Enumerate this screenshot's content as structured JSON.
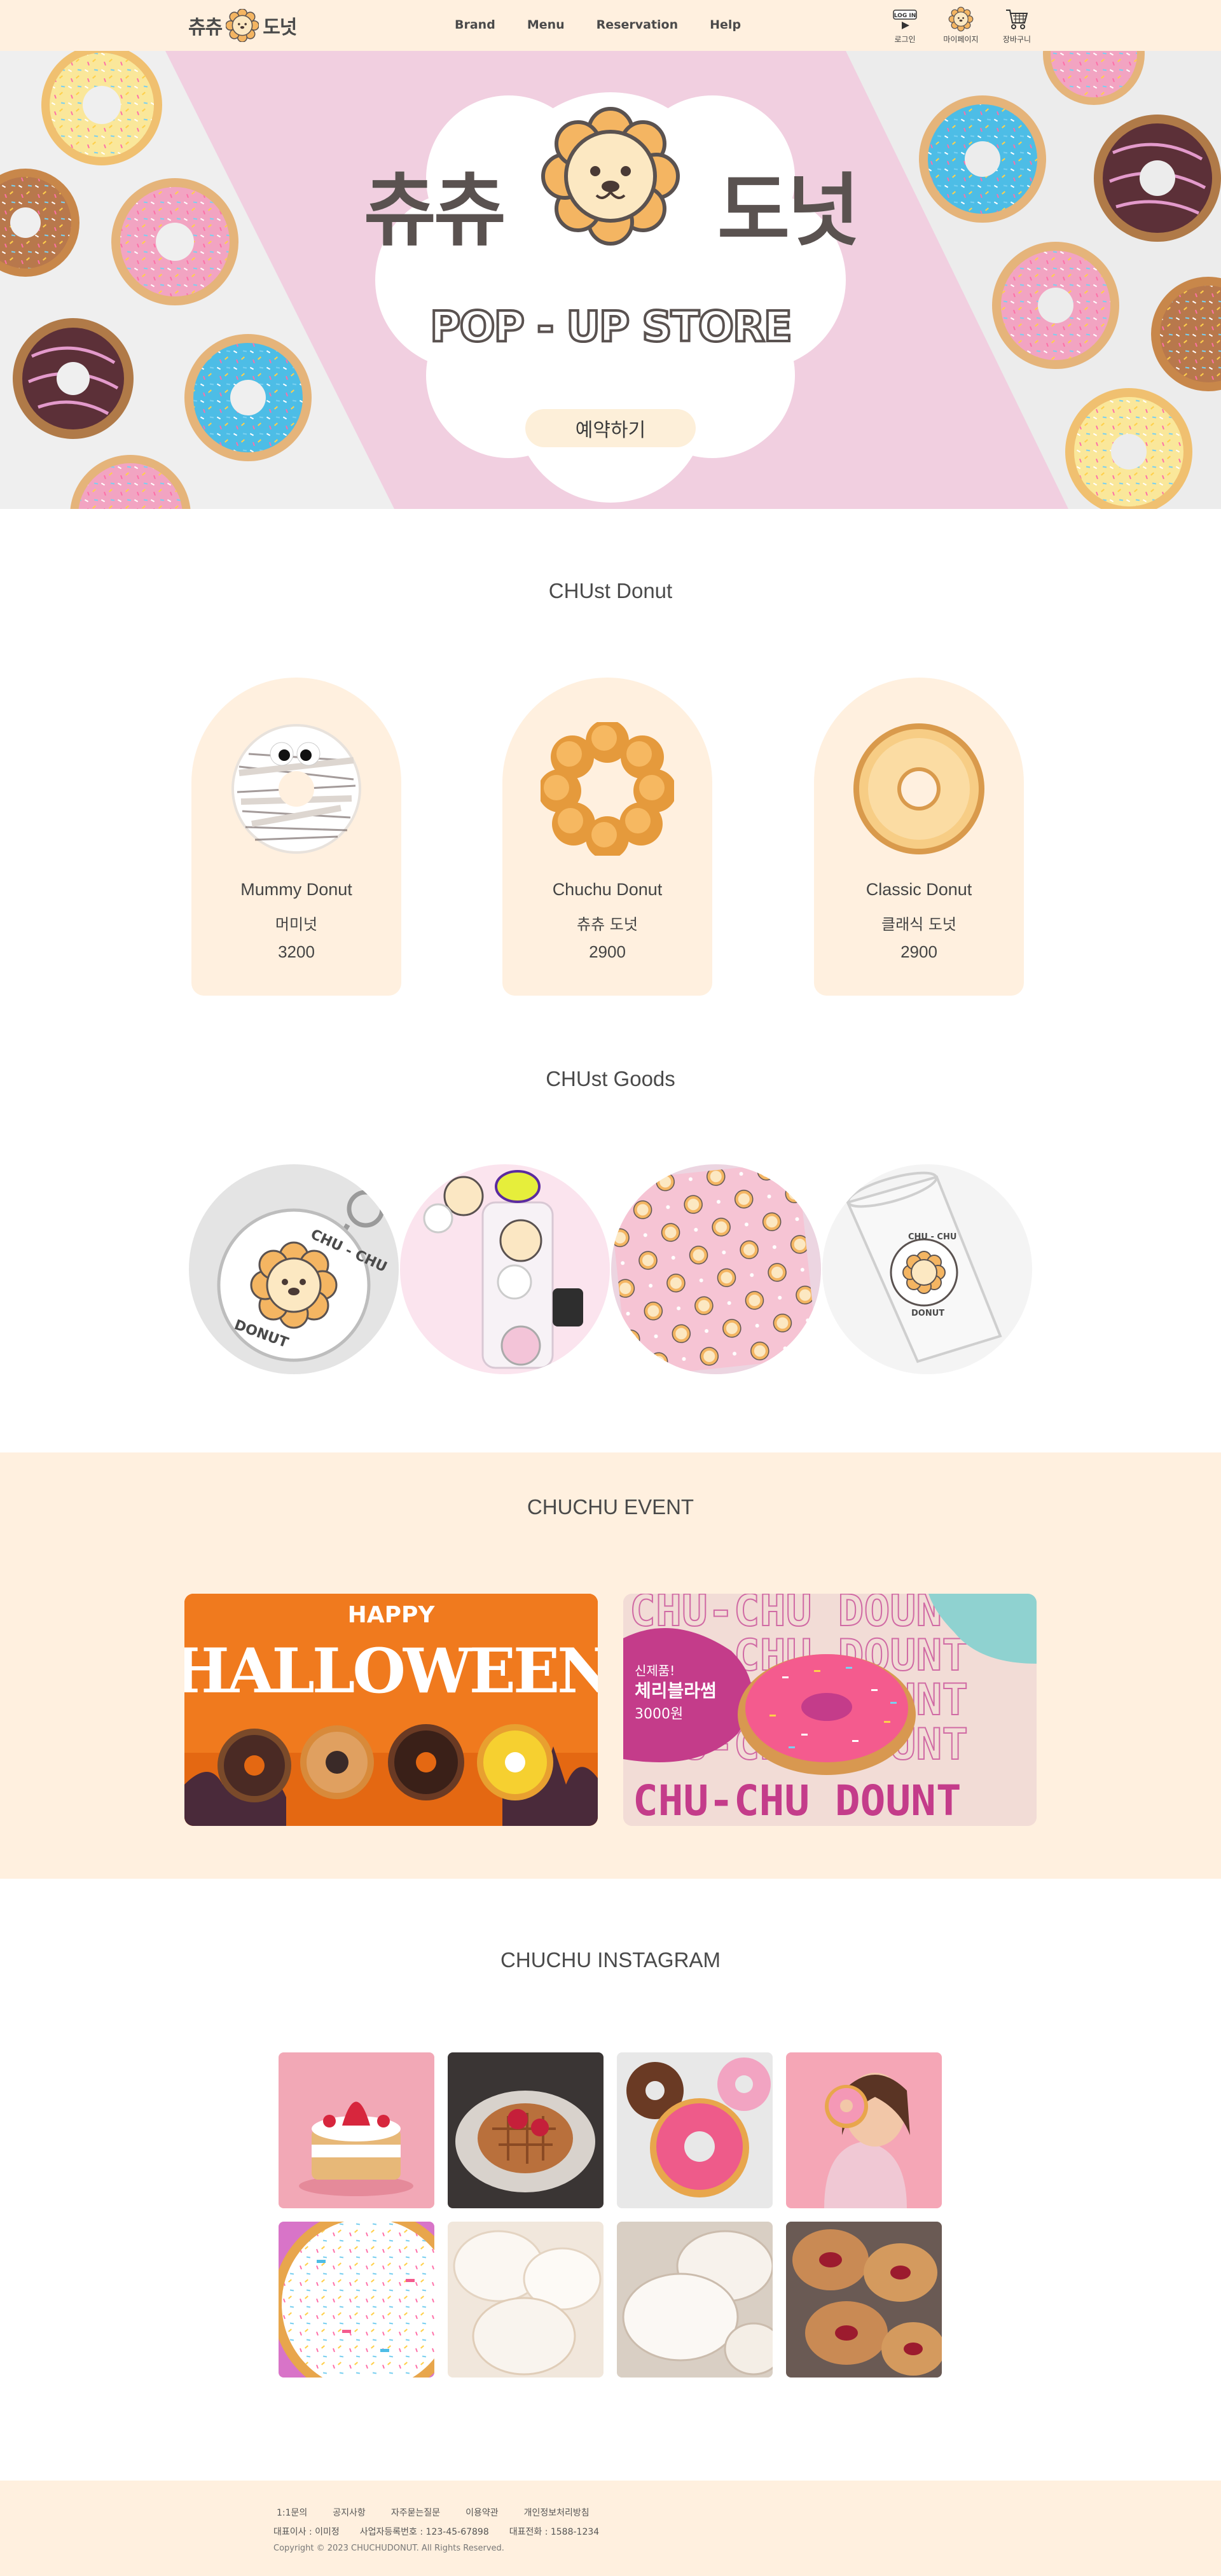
{
  "header": {
    "logo_text_left": "츄츄",
    "logo_text_right": "도넛",
    "nav": [
      "Brand",
      "Menu",
      "Reservation",
      "Help"
    ],
    "login_badge": "LOG IN",
    "login_label": "로그인",
    "mypage_label": "마이페이지",
    "cart_label": "장바구니"
  },
  "hero": {
    "title_left": "츄츄",
    "title_right": "도넛",
    "subtitle": "POP - UP STORE",
    "reserve_label": "예약하기"
  },
  "donuts": {
    "title": "CHUst Donut",
    "items": [
      {
        "name": "Mummy Donut",
        "name_ko": "머미넛",
        "price": "3200"
      },
      {
        "name": "Chuchu Donut",
        "name_ko": "츄츄 도넛",
        "price": "2900"
      },
      {
        "name": "Classic Donut",
        "name_ko": "클래식 도넛",
        "price": "2900"
      }
    ]
  },
  "goods": {
    "title": "CHUst Goods",
    "keyring_text_top": "CHU - CHU",
    "keyring_text_bottom": "DONUT",
    "cup_text_top": "CHU - CHU",
    "cup_text_bottom": "DONUT"
  },
  "event": {
    "title": "CHUCHU EVENT",
    "halloween_happy": "HAPPY",
    "halloween_title": "HALLOWEEN",
    "cherry_bg_text": "CHU-CHU DOUNT",
    "cherry_new": "신제품!",
    "cherry_name": "체리블라썸",
    "cherry_price": "3000원",
    "cherry_banner": "CHU-CHU DOUNT"
  },
  "instagram": {
    "title": "CHUCHU INSTAGRAM"
  },
  "footer": {
    "links": [
      "1:1문의",
      "공지사항",
      "자주묻는질문",
      "이용약관",
      "개인정보처리방침"
    ],
    "ceo": "대표이사 : 이미정",
    "biz_no": "사업자등록번호 : 123-45-67898",
    "phone": "대표전화 : 1588-1234",
    "copyright": "Copyright © 2023 CHUCHUDONUT. All Rights Reserved."
  },
  "colors": {
    "cream": "#fff0df",
    "pink": "#f1cfe0",
    "text": "#4a4a4a",
    "halloween_orange": "#f07a1e",
    "cherry_magenta": "#c43c8a"
  }
}
